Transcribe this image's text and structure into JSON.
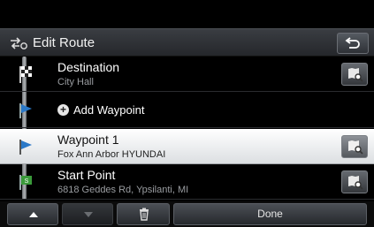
{
  "header": {
    "title": "Edit Route"
  },
  "rows": [
    {
      "title": "Destination",
      "subtitle": "City Hall"
    },
    {
      "add_label": "Add Waypoint"
    },
    {
      "title": "Waypoint 1",
      "subtitle": "Fox Ann Arbor HYUNDAI"
    },
    {
      "title": "Start Point",
      "subtitle": "6818 Geddes Rd, Ypsilanti, MI"
    }
  ],
  "footer": {
    "done_label": "Done"
  },
  "icons": [
    "edit-route-icon",
    "back-icon",
    "checkered-flag-icon",
    "waypoint-flag-icon",
    "start-flag-icon",
    "map-search-icon",
    "up-arrow-icon",
    "down-arrow-icon",
    "trash-icon"
  ],
  "colors": {
    "selected_row": "#ffffff",
    "start_flag": "#3a9a3a",
    "waypoint_flag": "#2a78c8"
  }
}
